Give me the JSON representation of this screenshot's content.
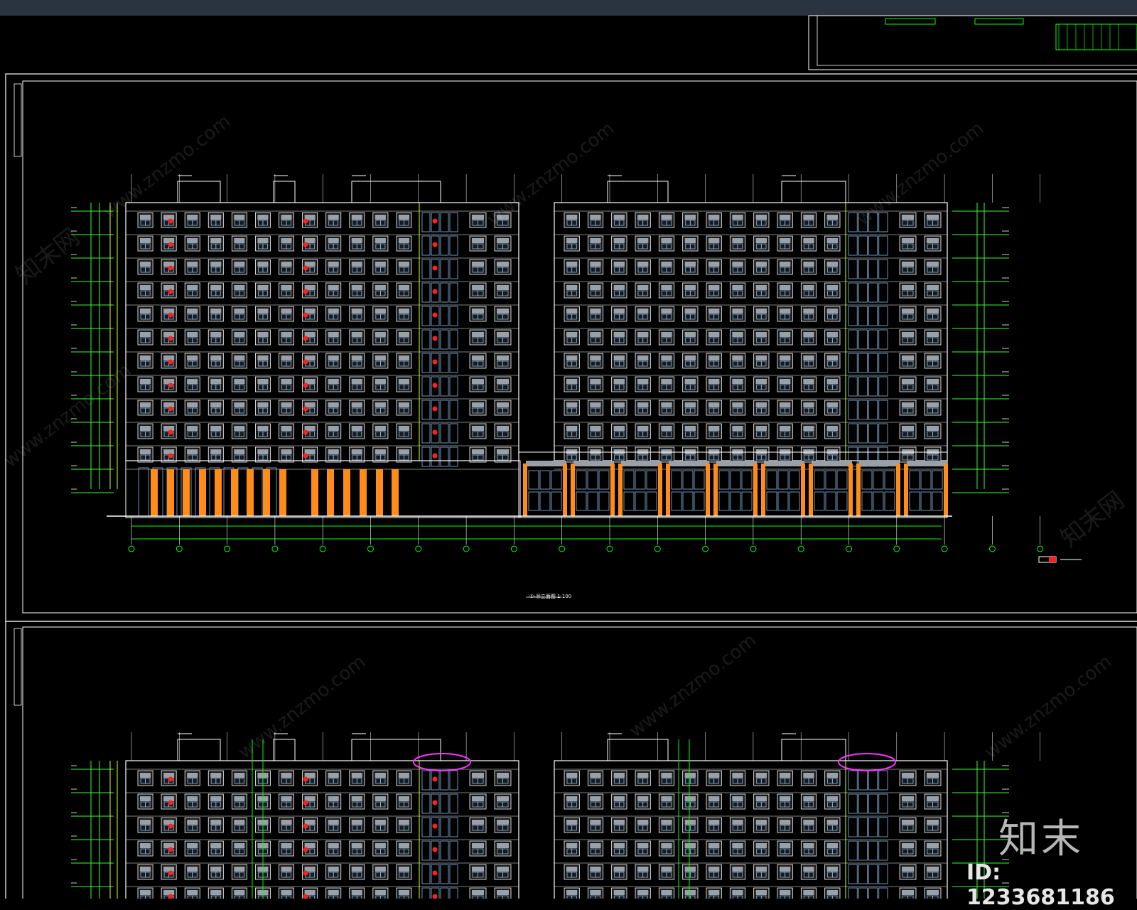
{
  "watermark": {
    "site_text": "www.znzmo.com",
    "cn_text": "知末网"
  },
  "brand": {
    "logo_text": "知末",
    "id_text": "ID: 1233681186"
  },
  "drawing": {
    "caption_text": "①-⑳立面图 1:100",
    "colors": {
      "background": "#000000",
      "frame": "#ffffff",
      "grid_line": "#00ff00",
      "level_line": "#33ff33",
      "window": "#8ab8e6",
      "window_fill": "#9aa0a8",
      "red_mark": "#ff2020",
      "orange_panel": "#ff8c1a",
      "magenta_cloud": "#ff33ff",
      "yellow_green": "#ccff33"
    },
    "floors_upper": 11,
    "axis_count": 20
  }
}
